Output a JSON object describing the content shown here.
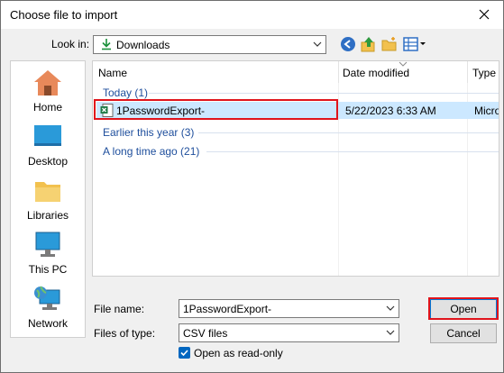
{
  "window": {
    "title": "Choose file to import"
  },
  "lookin": {
    "label": "Look in:",
    "value": "Downloads"
  },
  "toolbar": [
    "back-icon",
    "up-folder-icon",
    "new-folder-icon",
    "view-menu-icon"
  ],
  "places": [
    {
      "label": "Home",
      "icon": "home-icon"
    },
    {
      "label": "Desktop",
      "icon": "desktop-icon"
    },
    {
      "label": "Libraries",
      "icon": "libraries-icon"
    },
    {
      "label": "This PC",
      "icon": "this-pc-icon"
    },
    {
      "label": "Network",
      "icon": "network-icon"
    }
  ],
  "columns": {
    "name": "Name",
    "date": "Date modified",
    "type": "Type"
  },
  "groups": {
    "today": "Today (1)",
    "earlier": "Earlier this year (3)",
    "long_ago": "A long time ago (21)"
  },
  "file": {
    "name": "1PasswordExport-",
    "date": "5/22/2023 6:33 AM",
    "type": "Micro"
  },
  "form": {
    "filename_label": "File name:",
    "filename_value": "1PasswordExport-",
    "filetype_label": "Files of type:",
    "filetype_value": "CSV files",
    "readonly_label": "Open as read-only"
  },
  "buttons": {
    "open": "Open",
    "cancel": "Cancel"
  },
  "colors": {
    "highlight": "#e0141c",
    "selection": "#cce8ff",
    "group_text": "#1e4e9c"
  }
}
